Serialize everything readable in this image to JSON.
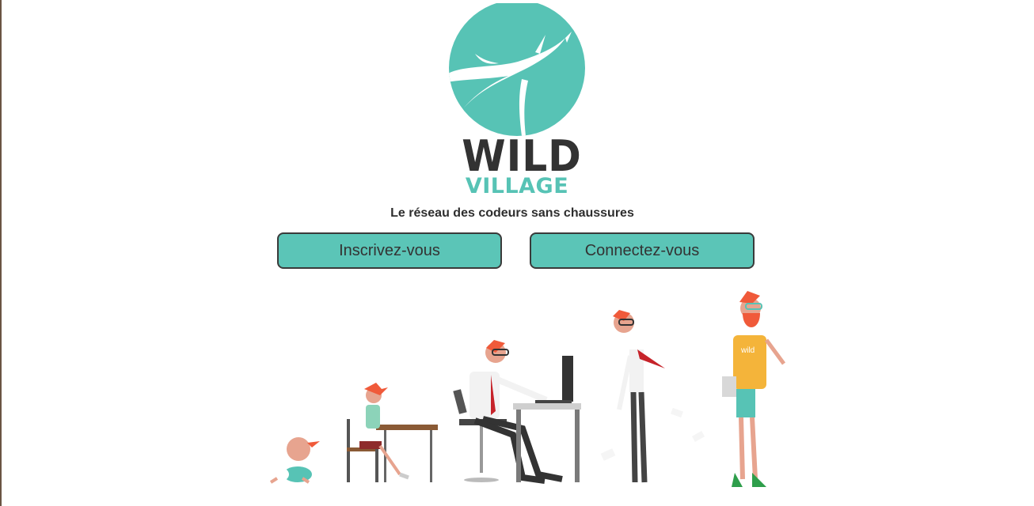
{
  "brand": {
    "name_line1": "WILD",
    "name_line2": "VILLAGE",
    "logo_icon": "whale-icon",
    "accent_color": "#57c3b5",
    "dark_color": "#323232"
  },
  "tagline": "Le réseau des codeurs sans chaussures",
  "actions": {
    "signup_label": "Inscrivez-vous",
    "login_label": "Connectez-vous"
  },
  "illustration": {
    "description_icon": "evolution-of-coder-illustration",
    "tshirt_text": "wild"
  }
}
